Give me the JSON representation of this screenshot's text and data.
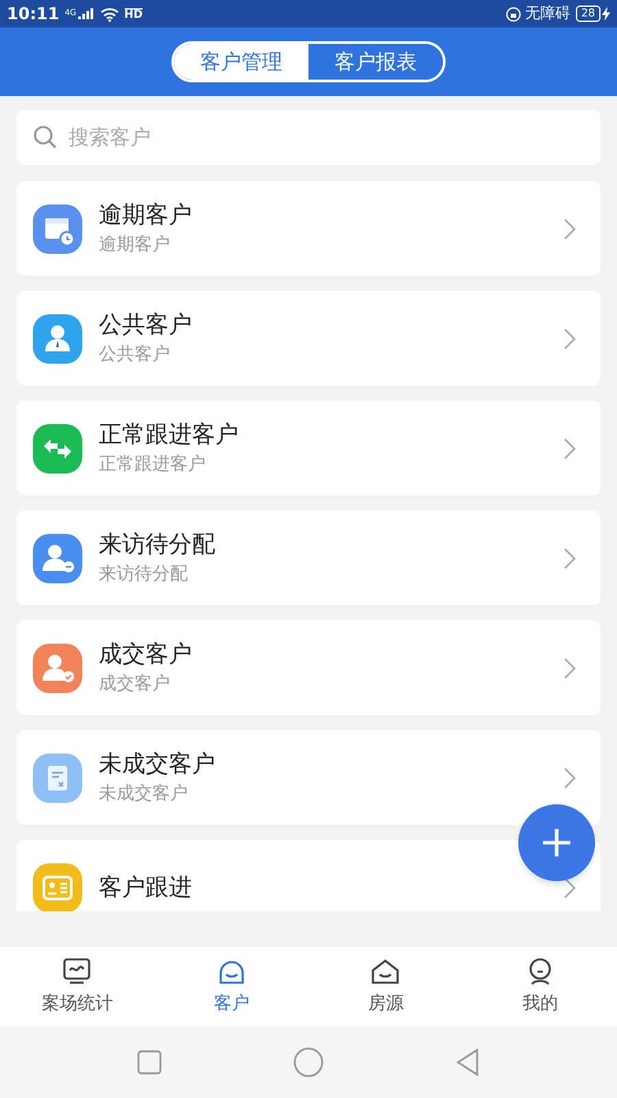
{
  "status_bar": {
    "time": "10:11",
    "network": "4G",
    "hd": "HD",
    "accessibility": "无障碍",
    "battery": "28"
  },
  "tabs": [
    {
      "label": "客户管理",
      "selected": true
    },
    {
      "label": "客户报表",
      "selected": false
    }
  ],
  "search": {
    "placeholder": "搜索客户"
  },
  "items": [
    {
      "kind": "calendar",
      "color": "#5b8ff0",
      "title": "逾期客户",
      "subtitle": "逾期客户"
    },
    {
      "kind": "person",
      "color": "#2fa4ee",
      "title": "公共客户",
      "subtitle": "公共客户"
    },
    {
      "kind": "exchange",
      "color": "#1dbb55",
      "title": "正常跟进客户",
      "subtitle": "正常跟进客户"
    },
    {
      "kind": "visitor",
      "color": "#4a8ef0",
      "title": "来访待分配",
      "subtitle": "来访待分配"
    },
    {
      "kind": "deal",
      "color": "#f2845a",
      "title": "成交客户",
      "subtitle": "成交客户"
    },
    {
      "kind": "document",
      "color": "#8ec0f5",
      "title": "未成交客户",
      "subtitle": "未成交客户"
    },
    {
      "kind": "card",
      "color": "#f2bd1c",
      "title": "客户跟进"
    }
  ],
  "bottom_tabs": [
    {
      "kind": "chart",
      "label": "案场统计",
      "selected": false
    },
    {
      "kind": "face",
      "label": "客户",
      "selected": true
    },
    {
      "kind": "house",
      "label": "房源",
      "selected": false
    },
    {
      "kind": "person",
      "label": "我的",
      "selected": false
    }
  ]
}
